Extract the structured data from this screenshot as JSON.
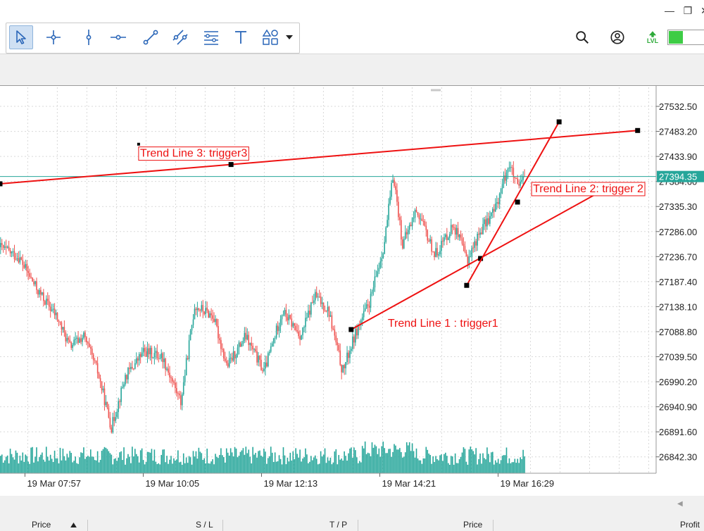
{
  "window": {
    "minimize_glyph": "—",
    "restore_glyph": "❐",
    "close_glyph": "✕"
  },
  "toolbar": {
    "tools": [
      {
        "name": "cursor-arrow-icon",
        "active": true
      },
      {
        "name": "crosshair-icon",
        "active": false
      },
      {
        "name": "vertical-line-icon",
        "active": false
      },
      {
        "name": "horizontal-line-icon",
        "active": false
      },
      {
        "name": "trend-line-icon",
        "active": false
      },
      {
        "name": "equidistant-channel-icon",
        "active": false
      },
      {
        "name": "fibonacci-lines-icon",
        "active": false
      },
      {
        "name": "text-tool-icon",
        "active": false
      },
      {
        "name": "shapes-icon",
        "active": false
      },
      {
        "name": "chevron-down-icon",
        "active": false
      }
    ],
    "right": {
      "search_icon": "search-icon",
      "account_icon": "account-icon",
      "lvl_label": "LVL"
    }
  },
  "chart_data": {
    "type": "candlestick",
    "x_tick_labels": [
      "19 Mar 07:57",
      "19 Mar 10:05",
      "19 Mar 12:13",
      "19 Mar 14:21",
      "19 Mar 16:29"
    ],
    "y_tick_labels": [
      "27532.50",
      "27483.20",
      "27433.90",
      "27384.60",
      "27335.30",
      "27286.00",
      "27236.70",
      "27187.40",
      "27138.10",
      "27088.80",
      "27039.50",
      "26990.20",
      "26940.90",
      "26891.60",
      "26842.30"
    ],
    "current_price": "27394.35",
    "y_range": [
      26810,
      27570
    ],
    "time_range": [
      "19 Mar 07:30",
      "19 Mar 19:20"
    ],
    "ticks_y": [
      27532.5,
      27483.2,
      27433.9,
      27384.6,
      27335.3,
      27286.0,
      27236.7,
      27187.4,
      27138.1,
      27088.8,
      27039.5,
      26990.2,
      26940.9,
      26891.6,
      26842.3
    ],
    "ticks_x": [
      "19 Mar 07:57",
      "19 Mar 10:05",
      "19 Mar 12:13",
      "19 Mar 14:21",
      "19 Mar 16:29"
    ],
    "price_path": [
      {
        "t": "19 Mar 07:30",
        "p": 27255
      },
      {
        "t": "19 Mar 07:50",
        "p": 27235
      },
      {
        "t": "19 Mar 08:10",
        "p": 27170
      },
      {
        "t": "19 Mar 08:30",
        "p": 27120
      },
      {
        "t": "19 Mar 08:45",
        "p": 27060
      },
      {
        "t": "19 Mar 09:00",
        "p": 27080
      },
      {
        "t": "19 Mar 09:15",
        "p": 27010
      },
      {
        "t": "19 Mar 09:30",
        "p": 26900
      },
      {
        "t": "19 Mar 09:45",
        "p": 27000
      },
      {
        "t": "19 Mar 10:05",
        "p": 27050
      },
      {
        "t": "19 Mar 10:25",
        "p": 27040
      },
      {
        "t": "19 Mar 10:45",
        "p": 26950
      },
      {
        "t": "19 Mar 11:00",
        "p": 27140
      },
      {
        "t": "19 Mar 11:20",
        "p": 27120
      },
      {
        "t": "19 Mar 11:35",
        "p": 27020
      },
      {
        "t": "19 Mar 11:55",
        "p": 27080
      },
      {
        "t": "19 Mar 12:15",
        "p": 27010
      },
      {
        "t": "19 Mar 12:35",
        "p": 27130
      },
      {
        "t": "19 Mar 12:55",
        "p": 27080
      },
      {
        "t": "19 Mar 13:10",
        "p": 27160
      },
      {
        "t": "19 Mar 13:25",
        "p": 27130
      },
      {
        "t": "19 Mar 13:40",
        "p": 27010
      },
      {
        "t": "19 Mar 13:55",
        "p": 27090
      },
      {
        "t": "19 Mar 14:10",
        "p": 27150
      },
      {
        "t": "19 Mar 14:25",
        "p": 27260
      },
      {
        "t": "19 Mar 14:35",
        "p": 27400
      },
      {
        "t": "19 Mar 14:45",
        "p": 27260
      },
      {
        "t": "19 Mar 15:00",
        "p": 27330
      },
      {
        "t": "19 Mar 15:20",
        "p": 27240
      },
      {
        "t": "19 Mar 15:40",
        "p": 27300
      },
      {
        "t": "19 Mar 15:55",
        "p": 27230
      },
      {
        "t": "19 Mar 16:10",
        "p": 27290
      },
      {
        "t": "19 Mar 16:25",
        "p": 27330
      },
      {
        "t": "19 Mar 16:40",
        "p": 27420
      },
      {
        "t": "19 Mar 16:50",
        "p": 27370
      },
      {
        "t": "19 Mar 16:58",
        "p": 27395
      }
    ],
    "trend_lines": [
      {
        "label": "Trend Line 1 : trigger1",
        "start": {
          "t": "19 Mar 13:50",
          "p": 27093
        },
        "end": {
          "t": "19 Mar 18:30",
          "p": 27375
        },
        "mid": {
          "t": "19 Mar 16:10",
          "p": 27233
        }
      },
      {
        "label": "Trend Line 2: trigger 2",
        "start": {
          "t": "19 Mar 15:55",
          "p": 27180
        },
        "end": {
          "t": "19 Mar 17:35",
          "p": 27502
        },
        "mid": {
          "t": "19 Mar 16:50",
          "p": 27344
        }
      },
      {
        "label": "Trend Line 3: trigger3",
        "start": {
          "t": "19 Mar 07:30",
          "p": 27380
        },
        "end": {
          "t": "19 Mar 19:00",
          "p": 27485
        },
        "mid": {
          "t": "19 Mar 11:40",
          "p": 27418
        }
      }
    ],
    "grid": true,
    "colors": {
      "up": "#26a69a",
      "down": "#ef5350",
      "trend_line": "#ee1111",
      "current_price_line": "#26a69a",
      "volume": "#26a69a"
    }
  },
  "bottom_panel": {
    "columns": [
      "Price",
      "S / L",
      "T / P",
      "Price",
      "Profit"
    ]
  }
}
